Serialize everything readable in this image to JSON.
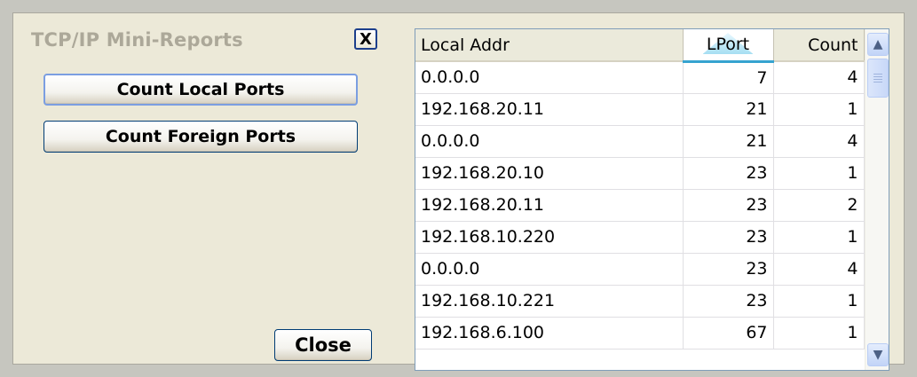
{
  "panel": {
    "title": "TCP/IP Mini-Reports",
    "close_x_label": "X"
  },
  "actions": {
    "count_local_label": "Count Local Ports",
    "count_foreign_label": "Count Foreign Ports",
    "close_label": "Close"
  },
  "grid": {
    "columns": [
      "Local Addr",
      "LPort",
      "Count"
    ],
    "sorted_column": "LPort",
    "rows": [
      [
        "0.0.0.0",
        "7",
        "4"
      ],
      [
        "192.168.20.11",
        "21",
        "1"
      ],
      [
        "0.0.0.0",
        "21",
        "4"
      ],
      [
        "192.168.20.10",
        "23",
        "1"
      ],
      [
        "192.168.20.11",
        "23",
        "2"
      ],
      [
        "192.168.10.220",
        "23",
        "1"
      ],
      [
        "0.0.0.0",
        "23",
        "4"
      ],
      [
        "192.168.10.221",
        "23",
        "1"
      ],
      [
        "192.168.6.100",
        "67",
        "1"
      ]
    ]
  },
  "icons": {
    "scroll_up": "chevron-up-icon",
    "scroll_down": "chevron-down-icon",
    "sort_ascending": "sort-ascending-icon"
  }
}
